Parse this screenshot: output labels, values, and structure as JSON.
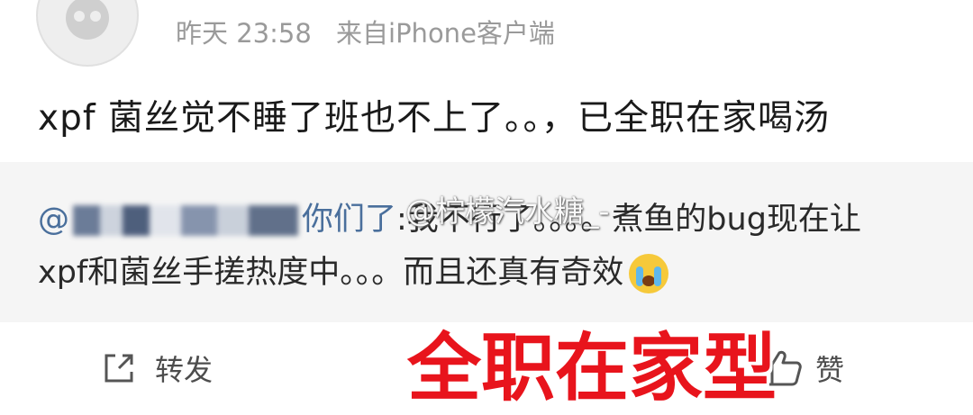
{
  "post": {
    "time": "昨天 23:58",
    "source": "来自iPhone客户端",
    "text": "xpf 菌丝觉不睡了班也不上了。。，已全职在家喝汤"
  },
  "quote": {
    "mention_prefix": "@",
    "mention_suffix": "你们了",
    "line1_text": ":我不行了。。。。煮鱼的bug现在让",
    "line2_text": "xpf和菌丝手搓热度中。。。而且还真有奇效",
    "watermark": "@柠檬汽水糖_-"
  },
  "actions": {
    "repost_label": "转发",
    "like_label": "赞"
  },
  "overlay_caption": "全职在家型",
  "icons": [
    "avatar",
    "repost-icon",
    "like-icon",
    "crying-emoji-icon"
  ],
  "colors": {
    "mention": "#4a6f9c",
    "meta": "#9a9a9a",
    "caption": "#e8141c",
    "quote_bg": "#f5f5f5"
  }
}
